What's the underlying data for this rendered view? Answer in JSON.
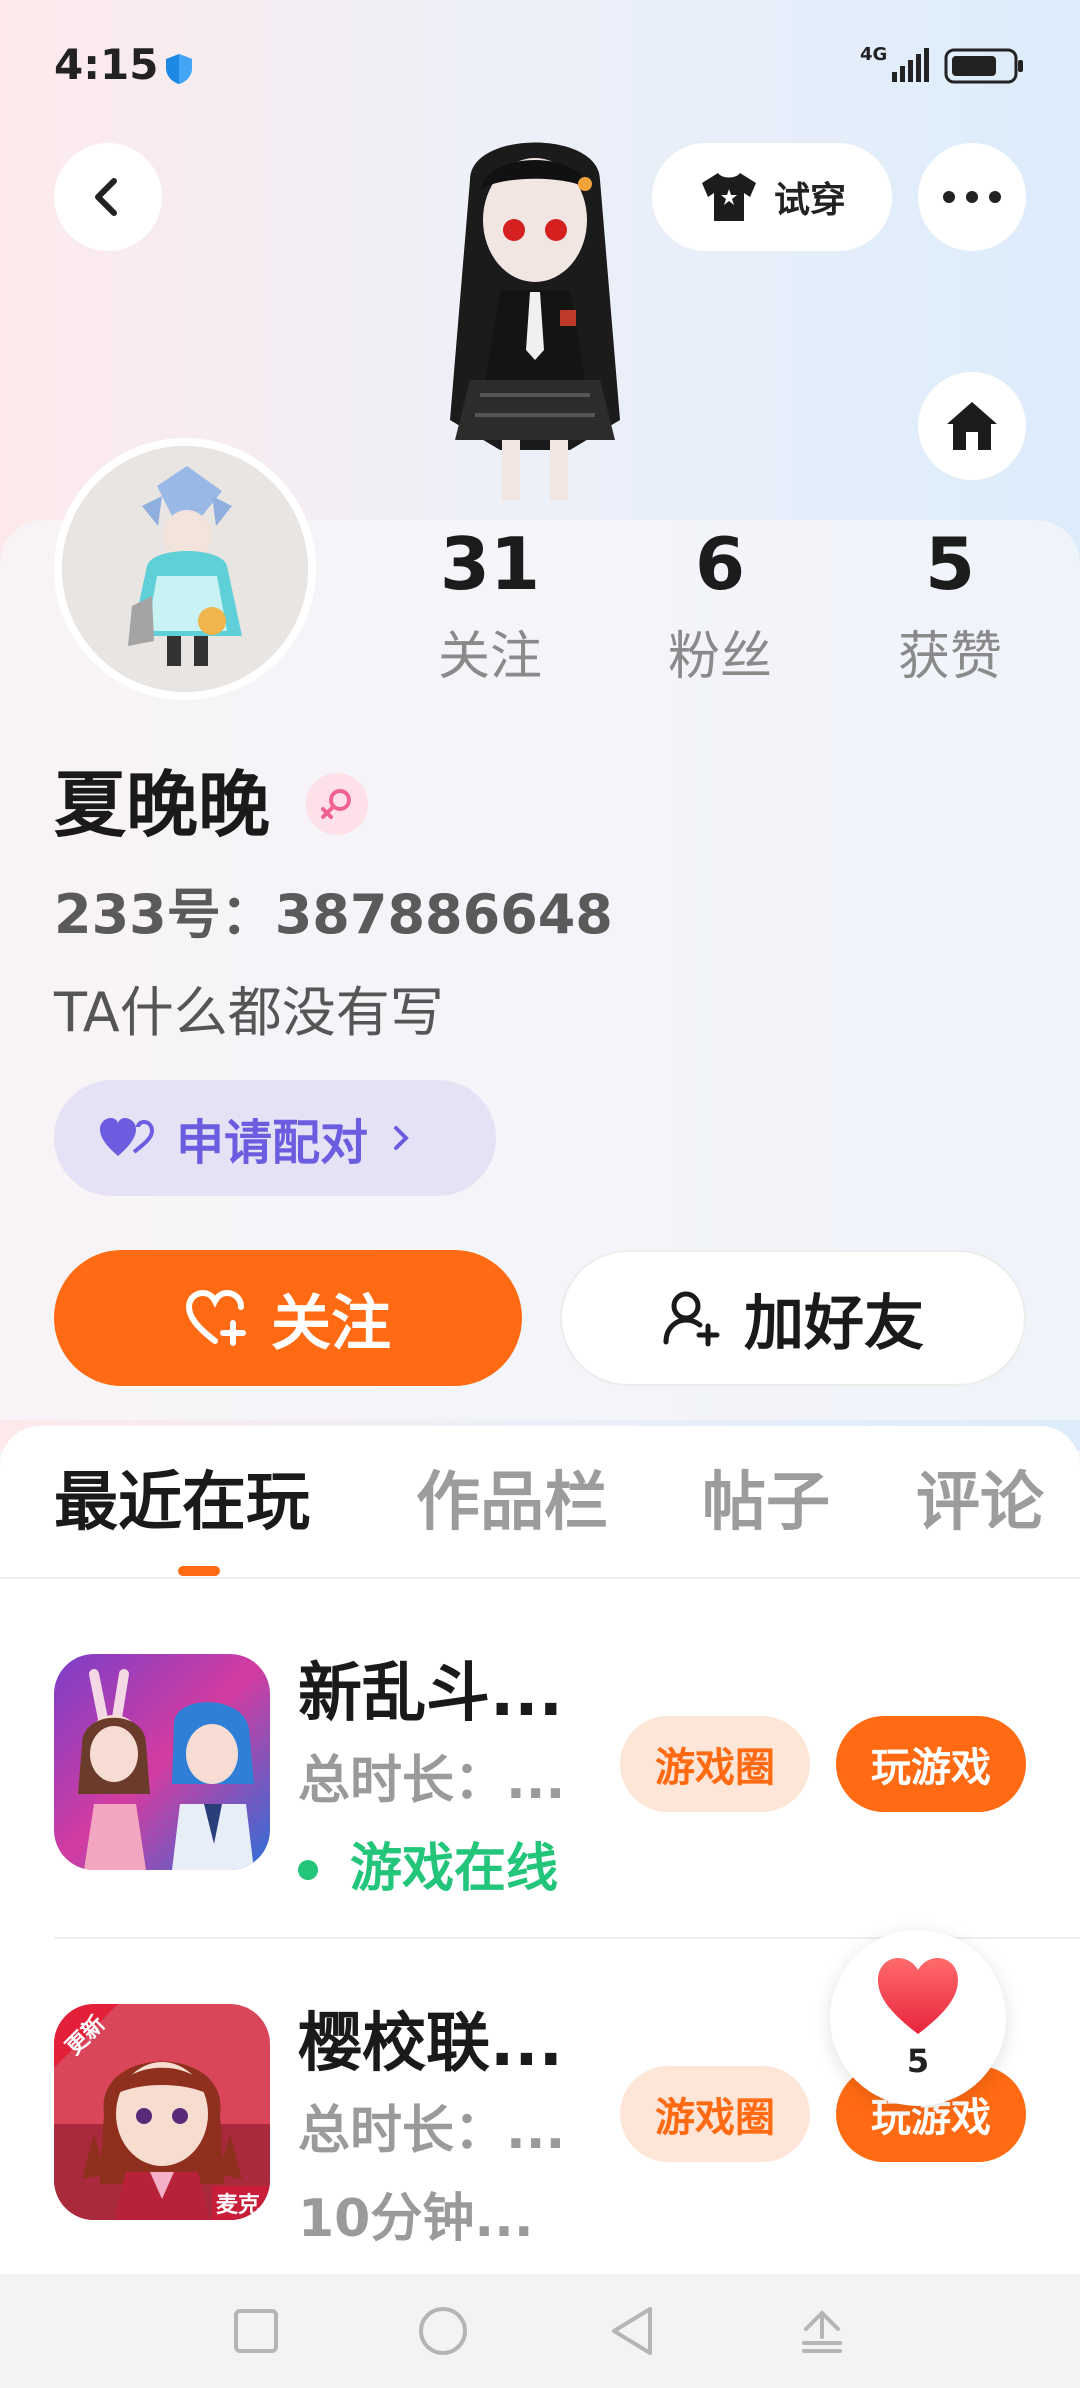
{
  "status_bar": {
    "time": "4:15",
    "network": "4G"
  },
  "header": {
    "try_on_label": "试穿"
  },
  "stats": [
    {
      "value": "31",
      "label": "关注"
    },
    {
      "value": "6",
      "label": "粉丝"
    },
    {
      "value": "5",
      "label": "获赞"
    }
  ],
  "profile": {
    "nickname": "夏晚晚",
    "uid": "233号：387886648",
    "bio": "TA什么都没有写",
    "pair_label": "申请配对"
  },
  "actions": {
    "follow_label": "关注",
    "add_friend_label": "加好友"
  },
  "tabs": [
    {
      "label": "最近在玩",
      "active": true
    },
    {
      "label": "作品栏",
      "active": false
    },
    {
      "label": "帖子",
      "active": false
    },
    {
      "label": "评论",
      "active": false
    }
  ],
  "games": [
    {
      "title": "新乱斗...",
      "time": "总时长：...",
      "status": "游戏在线",
      "circle_label": "游戏圈",
      "play_label": "玩游戏"
    },
    {
      "title": "樱校联...",
      "time": "总时长：...",
      "extra": "10分钟...",
      "circle_label": "游戏圈",
      "play_label": "玩游戏",
      "badge_new": "更新",
      "badge_mic": "麦克"
    }
  ],
  "like_float": {
    "count": "5"
  },
  "colors": {
    "accent": "#ff6a12",
    "online": "#22c57a",
    "pair": "#6b5ce0"
  }
}
